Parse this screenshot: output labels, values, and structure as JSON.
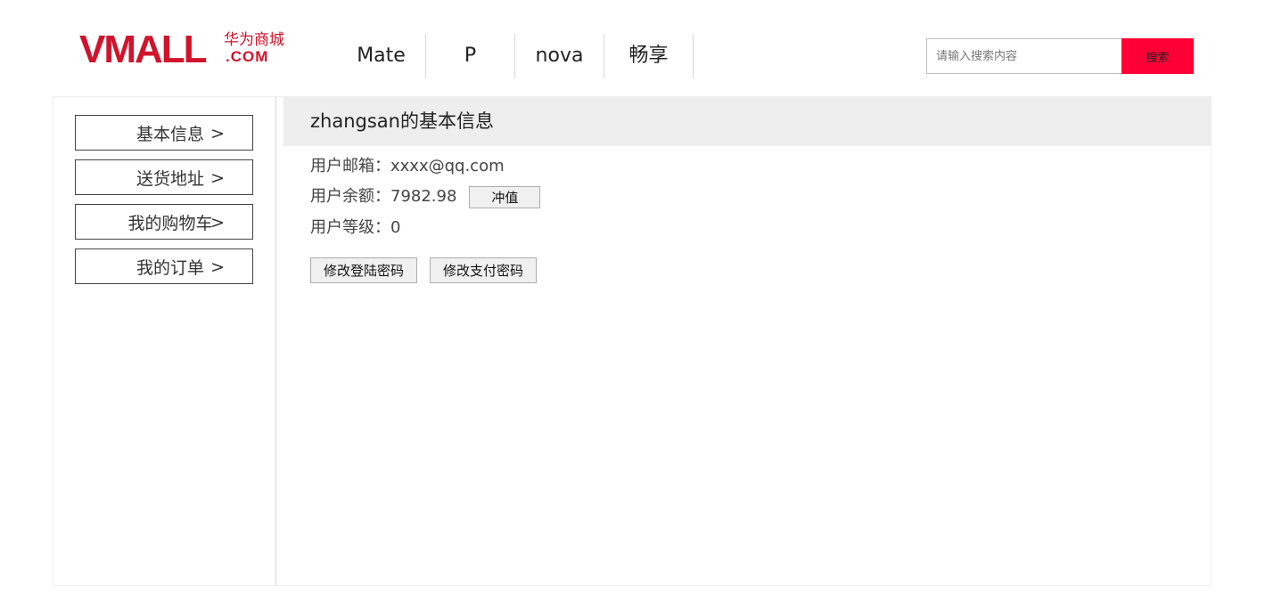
{
  "header": {
    "logo": {
      "main": "VMALL",
      "cn": "华为商城",
      "com": ".COM"
    },
    "nav": [
      "Mate",
      "P",
      "nova",
      "畅享"
    ],
    "search": {
      "placeholder": "请输入搜索内容",
      "button_label": "搜索"
    }
  },
  "sidebar": {
    "items": [
      {
        "label": "基本信息",
        "arrow": ">"
      },
      {
        "label": "送货地址",
        "arrow": ">"
      },
      {
        "label": "我的购物车",
        "arrow": ">"
      },
      {
        "label": "我的订单",
        "arrow": ">"
      }
    ]
  },
  "content": {
    "title": "zhangsan的基本信息",
    "email_label": "用户邮箱：",
    "email_value": "xxxx@qq.com",
    "balance_label": "用户余额：",
    "balance_value": "7982.98",
    "recharge_label": "冲值",
    "level_label": "用户等级：",
    "level_value": "0",
    "change_login_pwd": "修改登陆密码",
    "change_pay_pwd": "修改支付密码"
  },
  "colors": {
    "brand": "#d1132c",
    "search_button": "#ff0036",
    "header_bg": "#eeeeee"
  }
}
